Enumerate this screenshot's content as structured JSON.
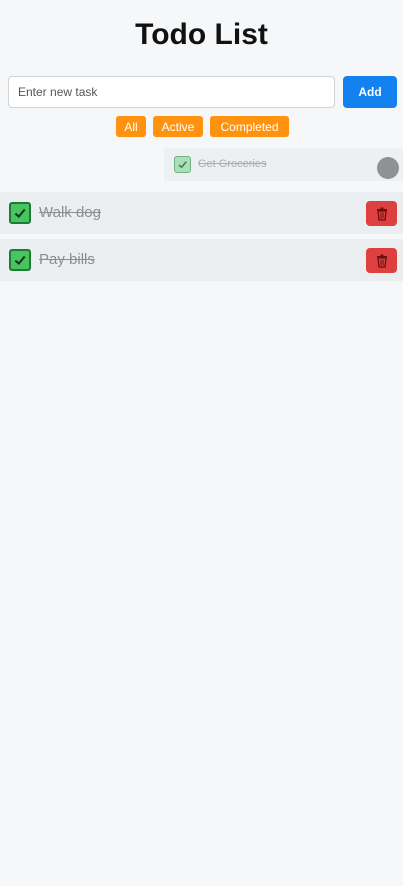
{
  "header": {
    "title": "Todo List"
  },
  "input": {
    "placeholder": "Enter new task",
    "value": ""
  },
  "add_button": {
    "label": "Add"
  },
  "filters": [
    {
      "label": "All"
    },
    {
      "label": "Active"
    },
    {
      "label": "Completed"
    }
  ],
  "ghost_task": {
    "text": "Get Groceries",
    "completed": true,
    "icon": "check-icon"
  },
  "tasks": [
    {
      "text": "Walk dog",
      "completed": true,
      "check_icon": "check-icon",
      "delete_icon": "trash-icon"
    },
    {
      "text": "Pay bills",
      "completed": true,
      "check_icon": "check-icon",
      "delete_icon": "trash-icon"
    }
  ],
  "colors": {
    "primary": "#1382f0",
    "filter": "#ff930f",
    "delete": "#de3f3f",
    "check": "#49c45f",
    "background": "#f5f7f8"
  }
}
